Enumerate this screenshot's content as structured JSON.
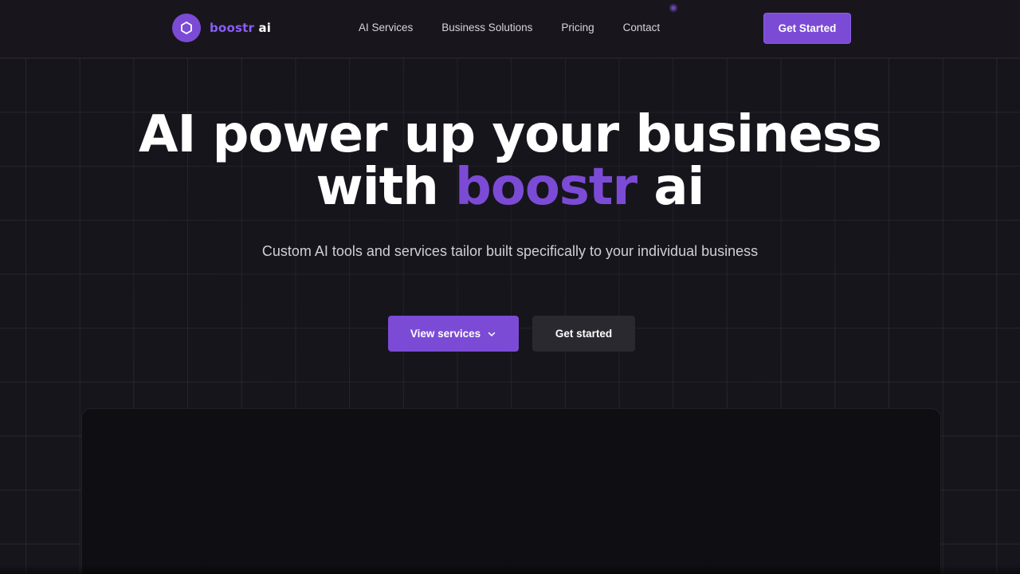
{
  "nav": {
    "logo": {
      "icon": "hexagon-icon",
      "brand_accent": "boostr",
      "brand_plain": "ai"
    },
    "links": [
      {
        "label": "AI Services"
      },
      {
        "label": "Business Solutions"
      },
      {
        "label": "Pricing"
      },
      {
        "label": "Contact"
      }
    ],
    "cta_label": "Get Started"
  },
  "hero": {
    "title_line1": "AI power up your business",
    "title_line2_plain": "with",
    "title_line2_accent": "boostr",
    "title_line2_end": "ai",
    "subtitle": "Custom AI tools and services tailor built specifically to your individual business",
    "primary_button": {
      "label": "View services",
      "icon": "chevron-down-icon"
    },
    "secondary_button": {
      "label": "Get started"
    }
  },
  "colors": {
    "background": "#17151c",
    "accent": "#7b4bd6",
    "secondary_button": "#2b2930",
    "preview_panel": "#0f0e12"
  }
}
